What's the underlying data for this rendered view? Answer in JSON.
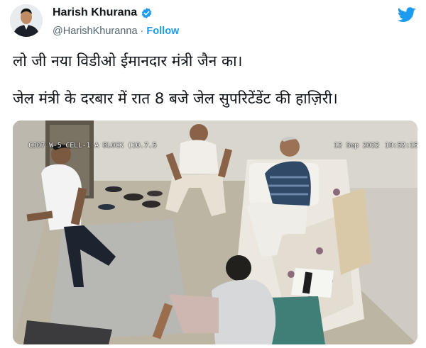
{
  "header": {
    "display_name": "Harish Khurana",
    "handle": "@HarishKhuranna",
    "separator": "·",
    "follow_label": "Follow"
  },
  "tweet": {
    "line1": "लो जी नया विडीओ ईमानदार मंत्री जैन का।",
    "line2": "जेल मंत्री के दरबार में रात 8 बजे जेल सुपरिटेंडेंट की हाज़िरी।"
  },
  "media": {
    "cctv_label": "CJ07 W-5 CELL-1 A BLOCK (10.7.5",
    "cctv_date": "12 Sep 2022",
    "cctv_time": "19:52:15"
  },
  "colors": {
    "accent": "#1d9bf0",
    "text": "#0f1419",
    "secondary": "#536471"
  },
  "icons": [
    "verified-badge-icon",
    "twitter-bird-icon"
  ]
}
